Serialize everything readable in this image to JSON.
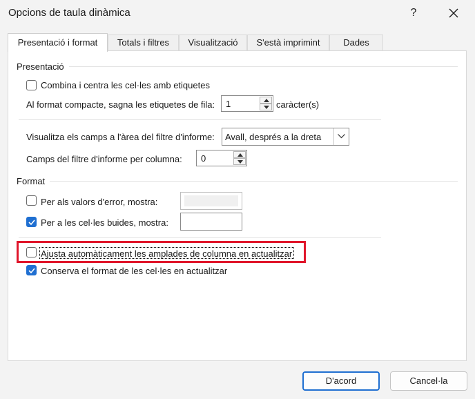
{
  "window": {
    "title": "Opcions de taula dinàmica",
    "help_label": "?"
  },
  "tabs": [
    {
      "label": "Presentació i format",
      "active": true
    },
    {
      "label": "Totals i filtres"
    },
    {
      "label": "Visualització"
    },
    {
      "label": "S'està imprimint"
    },
    {
      "label": "Dades"
    }
  ],
  "presentacio": {
    "heading": "Presentació",
    "merge_center": {
      "label": "Combina i centra les cel·les amb etiquetes",
      "checked": false
    },
    "indent": {
      "label": "Al format compacte, sagna les etiquetes de fila:",
      "value": "1",
      "unit": "caràcter(s)"
    },
    "filter_area": {
      "label": "Visualitza els camps a l'àrea del filtre d'informe:",
      "value": "Avall, després a la dreta"
    },
    "filter_per_col": {
      "label": "Camps del filtre d'informe per columna:",
      "value": "0"
    }
  },
  "format": {
    "heading": "Format",
    "error_values": {
      "label": "Per als valors d'error, mostra:",
      "checked": false,
      "value": ""
    },
    "empty_cells": {
      "label": "Per a les cel·les buides, mostra:",
      "checked": true,
      "value": ""
    },
    "autofit": {
      "label": "Ajusta automàticament les amplades de columna en actualitzar",
      "checked": false
    },
    "preserve": {
      "label": "Conserva el format de les cel·les en actualitzar",
      "checked": true
    }
  },
  "buttons": {
    "ok": "D'acord",
    "cancel": "Cancel·la"
  }
}
